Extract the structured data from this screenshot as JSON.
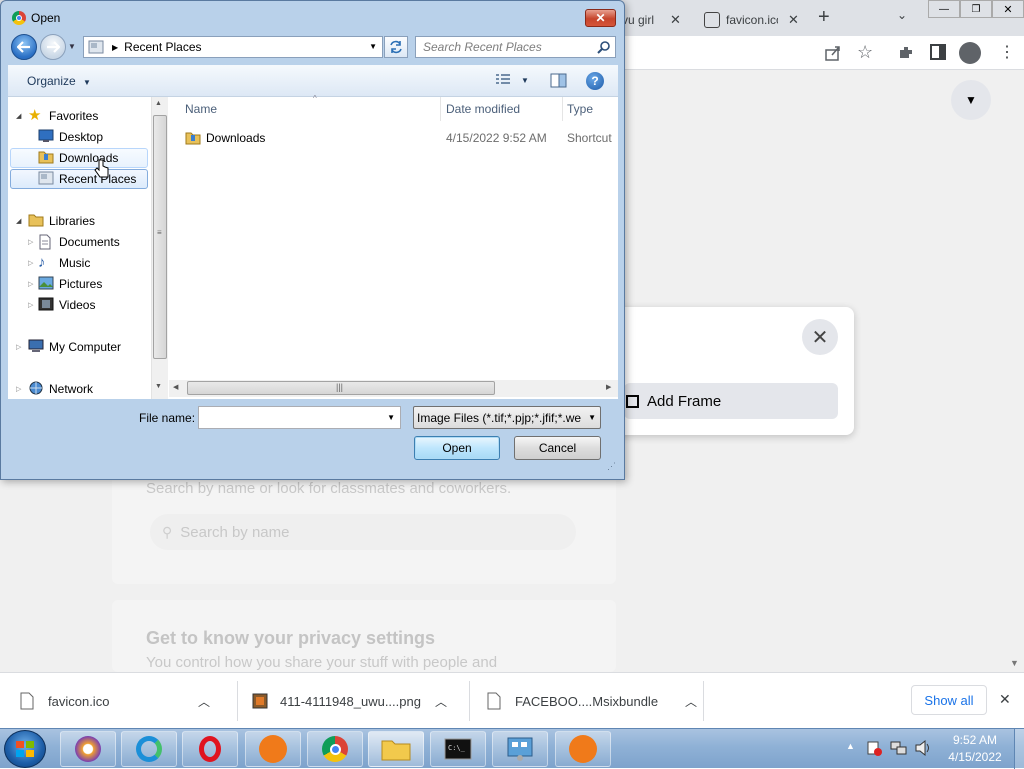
{
  "browser": {
    "tabs": [
      {
        "title": "vu girl"
      },
      {
        "title": "favicon.ico"
      }
    ],
    "new_tab_symbol": "+",
    "fb": {
      "add_frame_label": "Add Frame",
      "search_hint": "Search by name or look for classmates and coworkers.",
      "search_placeholder": "Search by name",
      "privacy_title": "Get to know your privacy settings",
      "privacy_sub": "You control how you share your stuff with people and"
    }
  },
  "dialog": {
    "title": "Open",
    "address": {
      "location": "Recent Places"
    },
    "search": {
      "placeholder": "Search Recent Places"
    },
    "toolbar": {
      "organize": "Organize"
    },
    "nav": {
      "favorites": "Favorites",
      "desktop": "Desktop",
      "downloads": "Downloads",
      "recent_places": "Recent Places",
      "libraries": "Libraries",
      "documents": "Documents",
      "music": "Music",
      "pictures": "Pictures",
      "videos": "Videos",
      "my_computer": "My Computer",
      "network": "Network"
    },
    "columns": {
      "name": "Name",
      "date_modified": "Date modified",
      "type": "Type"
    },
    "files": [
      {
        "name": "Downloads",
        "date": "4/15/2022 9:52 AM",
        "type": "Shortcut"
      }
    ],
    "file_name_label": "File name:",
    "file_name_value": "",
    "file_type": "Image Files (*.tif;*.pjp;*.jfif;*.we",
    "open_button": "Open",
    "cancel_button": "Cancel"
  },
  "downloads_bar": {
    "items": [
      {
        "name": "favicon.ico"
      },
      {
        "name": "411-4111948_uwu....png"
      },
      {
        "name": "FACEBOO....Msixbundle"
      }
    ],
    "show_all": "Show all"
  },
  "taskbar": {
    "time": "9:52 AM",
    "date": "4/15/2022"
  },
  "colors": {
    "dialog_frame": "#b9d1ea",
    "selection": "#dcebfc",
    "taskbar": "#8fb1d6",
    "close_button": "#c6452c"
  }
}
